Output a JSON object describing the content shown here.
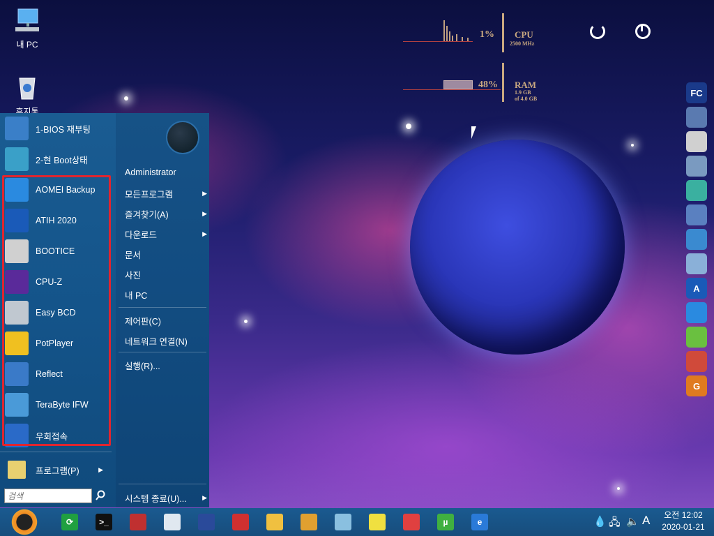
{
  "desktop": {
    "icons": [
      {
        "label": "내 PC",
        "icon": "computer-icon"
      },
      {
        "label": "휴지통",
        "icon": "recycle-bin-icon"
      }
    ]
  },
  "widgets": {
    "cpu": {
      "percent": "1%",
      "label": "CPU",
      "sub": "2500 MHz"
    },
    "ram": {
      "percent": "48%",
      "label": "RAM",
      "used": "1.9 GB",
      "total": "of 4.0 GB",
      "usage_fraction": 0.48
    }
  },
  "start_menu": {
    "pinned": [
      {
        "label": "1-BIOS 재부팅",
        "icon": "network-icon",
        "color": "#3a7fc8"
      },
      {
        "label": "2-현 Boot상태",
        "icon": "monitor-icon",
        "color": "#3aa0c8"
      },
      {
        "label": "AOMEI Backup",
        "icon": "aomei-icon",
        "color": "#2a8ae0"
      },
      {
        "label": "ATIH 2020",
        "icon": "acronis-icon",
        "color": "#1a5ab8"
      },
      {
        "label": "BOOTICE",
        "icon": "bootice-icon",
        "color": "#d0d0d0"
      },
      {
        "label": "CPU-Z",
        "icon": "cpuz-icon",
        "color": "#5a2a9a"
      },
      {
        "label": "Easy BCD",
        "icon": "easybcd-icon",
        "color": "#c0c8d0"
      },
      {
        "label": "PotPlayer",
        "icon": "potplayer-icon",
        "color": "#f0c020"
      },
      {
        "label": "Reflect",
        "icon": "reflect-icon",
        "color": "#3a7ac8"
      },
      {
        "label": "TeraByte IFW",
        "icon": "terabyte-icon",
        "color": "#4a9ad8"
      },
      {
        "label": "우회접속",
        "icon": "remote-icon",
        "color": "#2a6ac8"
      }
    ],
    "programs_label": "프로그램(P)",
    "search_placeholder": "검색",
    "right_items": [
      {
        "label": "Administrator",
        "has_arrow": false
      },
      {
        "label": "모든프로그램",
        "has_arrow": true
      },
      {
        "label": "즐겨찾기(A)",
        "has_arrow": true
      },
      {
        "label": "다운로드",
        "has_arrow": true
      },
      {
        "label": "문서",
        "has_arrow": false
      },
      {
        "label": "사진",
        "has_arrow": false
      },
      {
        "label": "내 PC",
        "has_arrow": false
      },
      {
        "label": "제어판(C)",
        "has_arrow": false
      },
      {
        "label": "네트워크 연결(N)",
        "has_arrow": false
      },
      {
        "label": "실행(R)...",
        "has_arrow": false
      }
    ],
    "shutdown_label": "시스템 종료(U)...",
    "arrow_glyph": "▶"
  },
  "dock": {
    "items": [
      {
        "icon": "fc-icon",
        "text": "FC",
        "color": "#1a3a8a"
      },
      {
        "icon": "computer-icon",
        "text": "",
        "color": "#5a7ab0"
      },
      {
        "icon": "floppy-icon",
        "text": "",
        "color": "#d0d0d0"
      },
      {
        "icon": "network-icon",
        "text": "",
        "color": "#7a9ac0"
      },
      {
        "icon": "book-icon",
        "text": "",
        "color": "#3ab0a0"
      },
      {
        "icon": "settings-pc-icon",
        "text": "",
        "color": "#5a80c0"
      },
      {
        "icon": "disk-icon",
        "text": "",
        "color": "#3a8ad0"
      },
      {
        "icon": "pc-tools-icon",
        "text": "",
        "color": "#8ab0d8"
      },
      {
        "icon": "acronis-icon",
        "text": "A",
        "color": "#1a5ab8"
      },
      {
        "icon": "aomei-icon",
        "text": "",
        "color": "#2a8ae0"
      },
      {
        "icon": "wand-icon",
        "text": "",
        "color": "#6ac040"
      },
      {
        "icon": "partition-icon",
        "text": "",
        "color": "#d04a3a"
      },
      {
        "icon": "g-icon",
        "text": "G",
        "color": "#e07a20"
      }
    ]
  },
  "taskbar": {
    "apps": [
      {
        "icon": "refresh-app-icon",
        "text": "⟳",
        "color": "#20a040"
      },
      {
        "icon": "cmd-icon",
        "text": ">_",
        "color": "#101010"
      },
      {
        "icon": "cubes-icon",
        "text": "",
        "color": "#c03030"
      },
      {
        "icon": "grid-app-icon",
        "text": "",
        "color": "#e0e8f0"
      },
      {
        "icon": "save-icon",
        "text": "",
        "color": "#2a4a9a"
      },
      {
        "icon": "stamp-icon",
        "text": "",
        "color": "#d03030"
      },
      {
        "icon": "folder-icon",
        "text": "",
        "color": "#f0c040"
      },
      {
        "icon": "pencil-icon",
        "text": "",
        "color": "#e0a030"
      },
      {
        "icon": "eraser-icon",
        "text": "",
        "color": "#8ac0e0"
      },
      {
        "icon": "note-icon",
        "text": "",
        "color": "#f0e040"
      },
      {
        "icon": "chart-app-icon",
        "text": "",
        "color": "#e04040"
      },
      {
        "icon": "utorrent-icon",
        "text": "µ",
        "color": "#40b040"
      },
      {
        "icon": "ie-icon",
        "text": "e",
        "color": "#2a7ad8"
      }
    ],
    "tray": {
      "ime": "A",
      "clock_period": "오전",
      "clock_time": "12:02",
      "date": "2020-01-21"
    }
  }
}
